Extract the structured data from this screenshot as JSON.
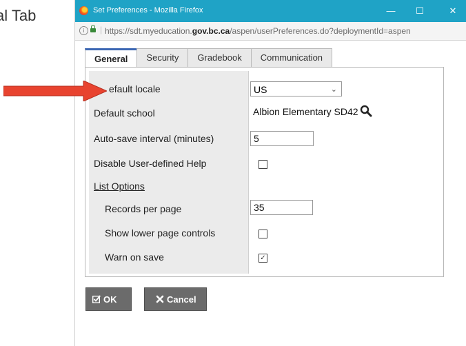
{
  "background_text": "al Tab",
  "window": {
    "title": "Set Preferences - Mozilla Firefox",
    "minimize": "—",
    "maximize": "☐",
    "close": "✕"
  },
  "urlbar": {
    "url_prefix": "https://sdt.myeducation.",
    "url_domain": "gov.bc.ca",
    "url_suffix": "/aspen/userPreferences.do?deploymentId=aspen"
  },
  "tabs": [
    "General",
    "Security",
    "Gradebook",
    "Communication"
  ],
  "form": {
    "default_locale_label": "efault locale",
    "default_locale_value": "US",
    "default_school_label": "Default school",
    "default_school_value": "Albion Elementary SD42",
    "autosave_label": "Auto-save interval (minutes)",
    "autosave_value": "5",
    "disable_help_label": "Disable User-defined Help",
    "list_options_label": "List Options",
    "records_per_page_label": "Records per page",
    "records_per_page_value": "35",
    "show_lower_controls_label": "Show lower page controls",
    "warn_on_save_label": "Warn on save",
    "disable_help_checked": false,
    "show_lower_controls_checked": false,
    "warn_on_save_checked": true
  },
  "buttons": {
    "ok_label": "OK",
    "cancel_label": "Cancel"
  },
  "colors": {
    "titlebar": "#1fa3c6",
    "tab_active_accent": "#3b66b3",
    "arrow": "#e8432f",
    "button_bg": "#6b6b6b"
  },
  "icons": {
    "browser": "firefox-icon",
    "lock": "lock-icon",
    "search": "magnifier-icon",
    "ok": "check-square-icon",
    "cancel": "x-icon"
  }
}
